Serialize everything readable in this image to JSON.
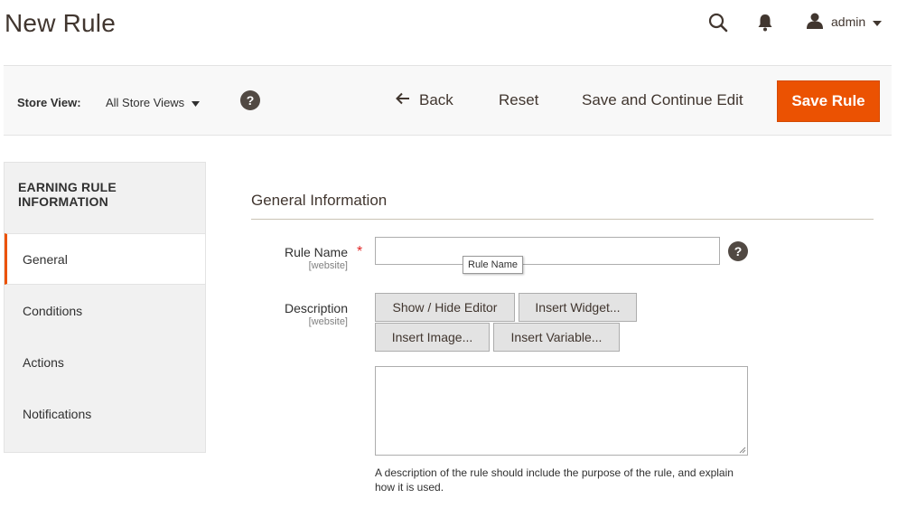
{
  "header": {
    "page_title": "New Rule",
    "user_name": "admin",
    "icons": [
      "search-icon",
      "notifications-bell-icon",
      "user-icon"
    ]
  },
  "toolbar": {
    "store_view_label": "Store View:",
    "store_view_value": "All Store Views",
    "help_glyph": "?",
    "back_label": "Back",
    "reset_label": "Reset",
    "save_continue_label": "Save and Continue Edit",
    "save_label": "Save Rule"
  },
  "sidebar": {
    "title": "EARNING RULE INFORMATION",
    "items": [
      {
        "label": "General",
        "active": true
      },
      {
        "label": "Conditions",
        "active": false
      },
      {
        "label": "Actions",
        "active": false
      },
      {
        "label": "Notifications",
        "active": false
      }
    ]
  },
  "form": {
    "section_title": "General Information",
    "rule_name": {
      "label": "Rule Name",
      "required_mark": "*",
      "scope": "[website]",
      "value": "",
      "tooltip": "Rule Name"
    },
    "description": {
      "label": "Description",
      "scope": "[website]",
      "buttons": [
        "Show / Hide Editor",
        "Insert Widget...",
        "Insert Image...",
        "Insert Variable..."
      ],
      "value": "",
      "note": "A description of the rule should include the purpose of the rule, and explain how it is used."
    }
  },
  "colors": {
    "accent": "#eb5202",
    "title_text": "#41362f",
    "sidebar_bg": "#f1f1f1",
    "toolbar_bg": "#f8f8f8"
  }
}
